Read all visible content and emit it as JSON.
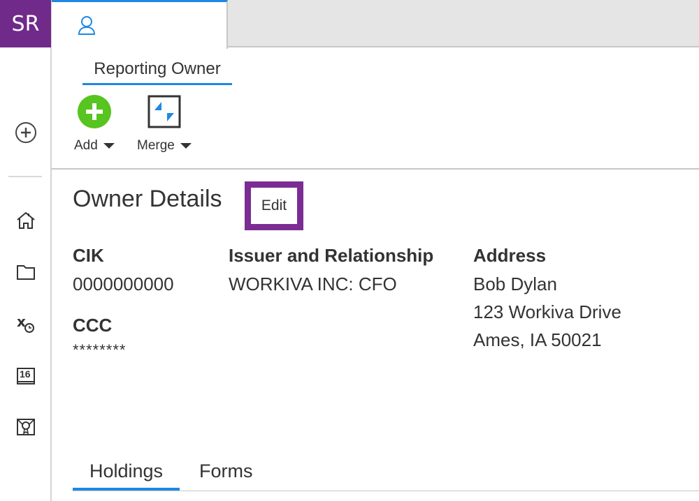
{
  "user": {
    "initials": "SR",
    "avatar_color": "#6f2a8a"
  },
  "top_tab": {
    "icon": "user-icon"
  },
  "ribbon": {
    "tab_label": "Reporting Owner",
    "tools": [
      {
        "label": "Add",
        "icon": "add-circle-icon",
        "color": "#57c41f"
      },
      {
        "label": "Merge",
        "icon": "merge-icon"
      }
    ]
  },
  "rail": {
    "items": [
      "create-icon",
      "home-icon",
      "folder-icon",
      "tasks-icon",
      "calendar-icon",
      "certificate-icon"
    ],
    "calendar_day": "16"
  },
  "details": {
    "title": "Owner Details",
    "edit_label": "Edit",
    "cik_label": "CIK",
    "cik_value": "0000000000",
    "ccc_label": "CCC",
    "ccc_value": "********",
    "issuer_label": "Issuer and Relationship",
    "issuer_value": "WORKIVA INC: CFO",
    "address_label": "Address",
    "address_lines": [
      "Bob Dylan",
      "123 Workiva Drive",
      "Ames, IA 50021"
    ]
  },
  "bottom_tabs": [
    "Holdings",
    "Forms"
  ],
  "colors": {
    "accent": "#1e88e5",
    "highlight": "#7b2d93"
  }
}
